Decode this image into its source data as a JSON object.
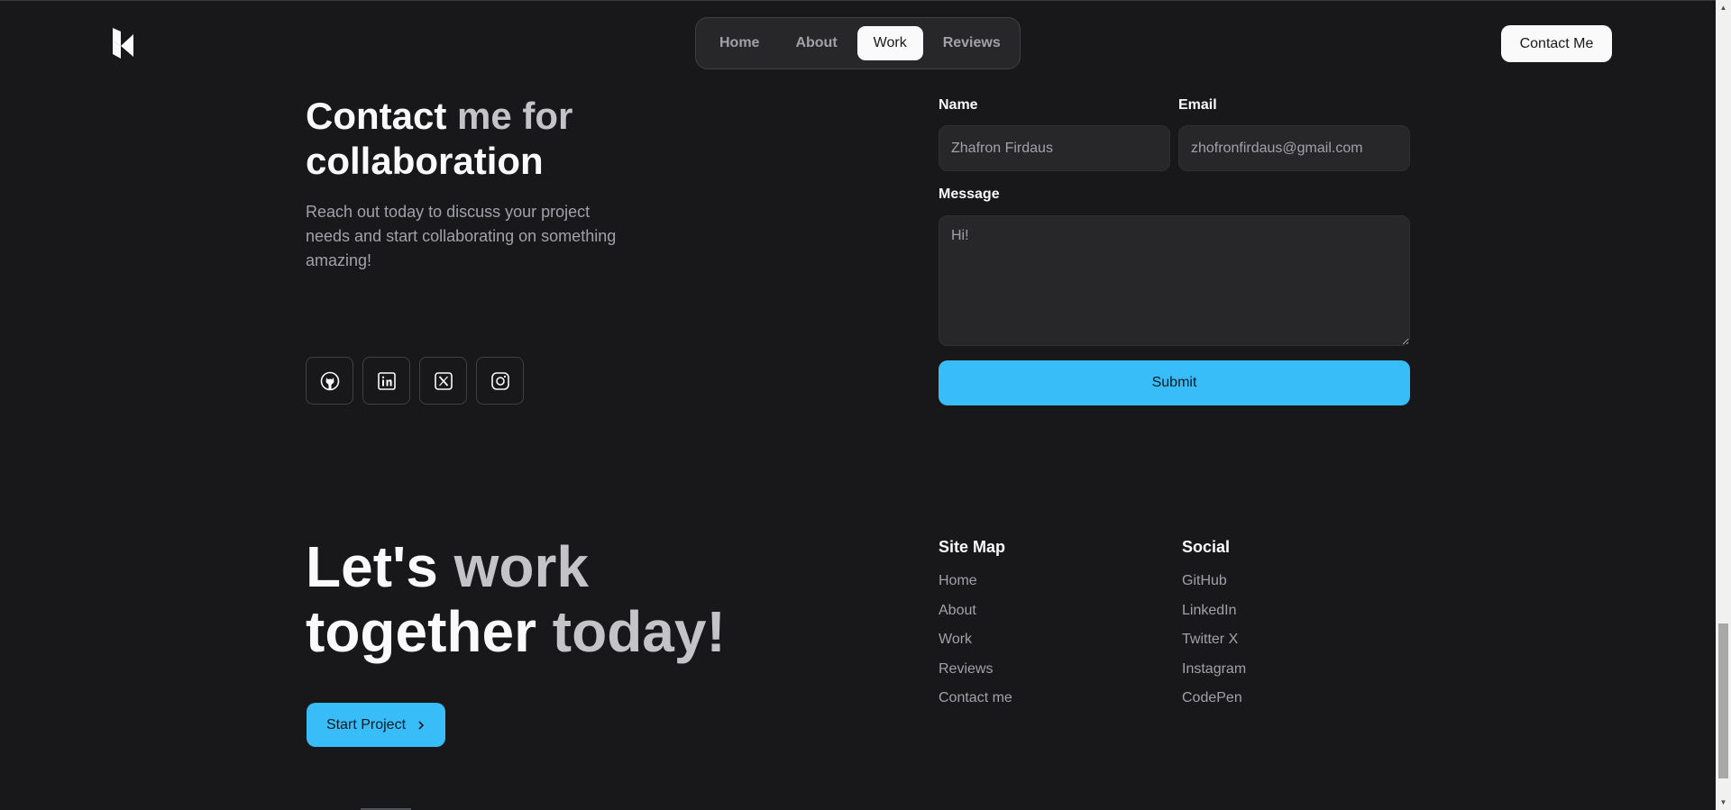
{
  "header": {
    "logo_icon": "brand-logo-icon",
    "nav": [
      "Home",
      "About",
      "Work",
      "Reviews"
    ],
    "active_nav": "Work",
    "contact_label": "Contact Me"
  },
  "contact": {
    "title_strong": "Contact ",
    "title_muted": "me for",
    "title_line2": "collaboration",
    "description": "Reach out today to discuss your project needs and start collaborating on something amazing!",
    "socials": [
      "github-icon",
      "linkedin-icon",
      "x-icon",
      "instagram-icon"
    ]
  },
  "form": {
    "name_label": "Name",
    "name_value": "Zhafron Firdaus",
    "email_label": "Email",
    "email_value": "zhofronfirdaus@gmail.com",
    "message_label": "Message",
    "message_value": "Hi!",
    "submit_label": "Submit"
  },
  "cta": {
    "line1_strong": "Let's ",
    "line1_muted": "work",
    "line2_strong": "together ",
    "line2_muted": "today!",
    "button_label": "Start Project"
  },
  "footer": {
    "sitemap_title": "Site Map",
    "sitemap": [
      "Home",
      "About",
      "Work",
      "Reviews",
      "Contact me"
    ],
    "social_title": "Social",
    "social": [
      "GitHub",
      "LinkedIn",
      "Twitter X",
      "Instagram",
      "CodePen"
    ]
  },
  "colors": {
    "background": "#18181b",
    "accent": "#38bdf8",
    "surface": "#27272a"
  }
}
